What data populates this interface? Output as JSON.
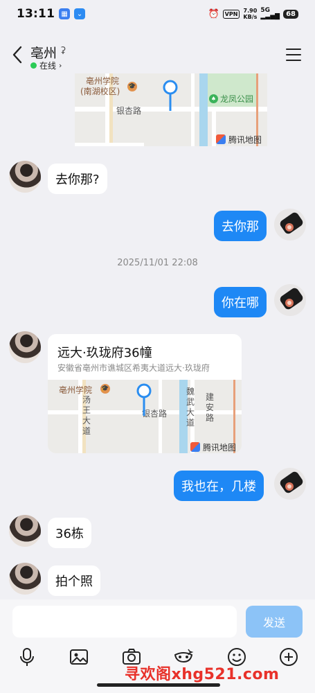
{
  "status_bar": {
    "time": "13:11",
    "vpn": "VPN",
    "speed_value": "7.90",
    "speed_unit": "KB/s",
    "network": "5G",
    "battery": "68"
  },
  "header": {
    "name": "亳州",
    "status": "在线"
  },
  "map_top": {
    "poi_school": "亳州学院",
    "poi_campus": "(南湖校区)",
    "road": "银杏路",
    "park": "龙凤公园",
    "brand": "腾讯地图"
  },
  "messages": {
    "m1": "去你那?",
    "m2": "去你那",
    "timestamp": "2025/11/01 22:08",
    "m3": "你在哪",
    "location": {
      "title": "远大·玖珑府36幢",
      "address": "安徽省亳州市谯城区希夷大道远大·玖珑府",
      "poi_school": "亳州学院",
      "road1": "汤王大道",
      "road2": "银杏路",
      "road3": "魏武大道",
      "road4": "建安路",
      "brand": "腾讯地图"
    },
    "m4": "我也在，几楼",
    "m5": "36栋",
    "m6": "拍个照"
  },
  "composer": {
    "send_label": "发送",
    "watermark": "寻欢阁xhg521.com"
  },
  "colors": {
    "accent": "#1e88f5",
    "online": "#2bcb56",
    "send_disabled": "#8cc3f7"
  }
}
